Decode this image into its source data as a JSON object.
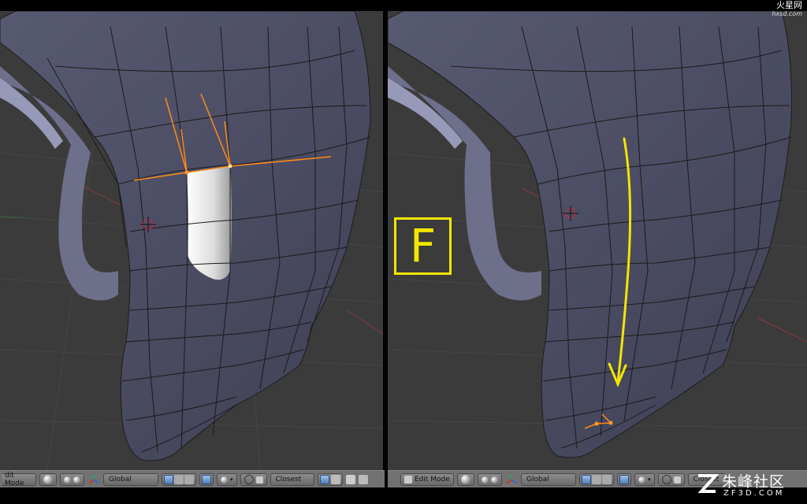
{
  "left_view": {
    "header": {
      "mode_label": "dit Mode",
      "transform_orientation": "Global",
      "snap_target": "Closest"
    }
  },
  "right_view": {
    "header": {
      "mode_label": "Edit Mode",
      "transform_orientation": "Global",
      "snap_target": "Closest"
    },
    "key_hint": "F"
  },
  "watermarks": {
    "top_brand": "火星网",
    "top_url": "hxsd.com",
    "bottom_brand": "朱峰社区",
    "bottom_url": "ZF3D.COM"
  },
  "colors": {
    "viewport_bg": "#3b3b3b",
    "mesh_face": "#4e4f66",
    "selection": "#ff8a1a",
    "annotation": "#f2e600",
    "header_bg": "#727272"
  }
}
